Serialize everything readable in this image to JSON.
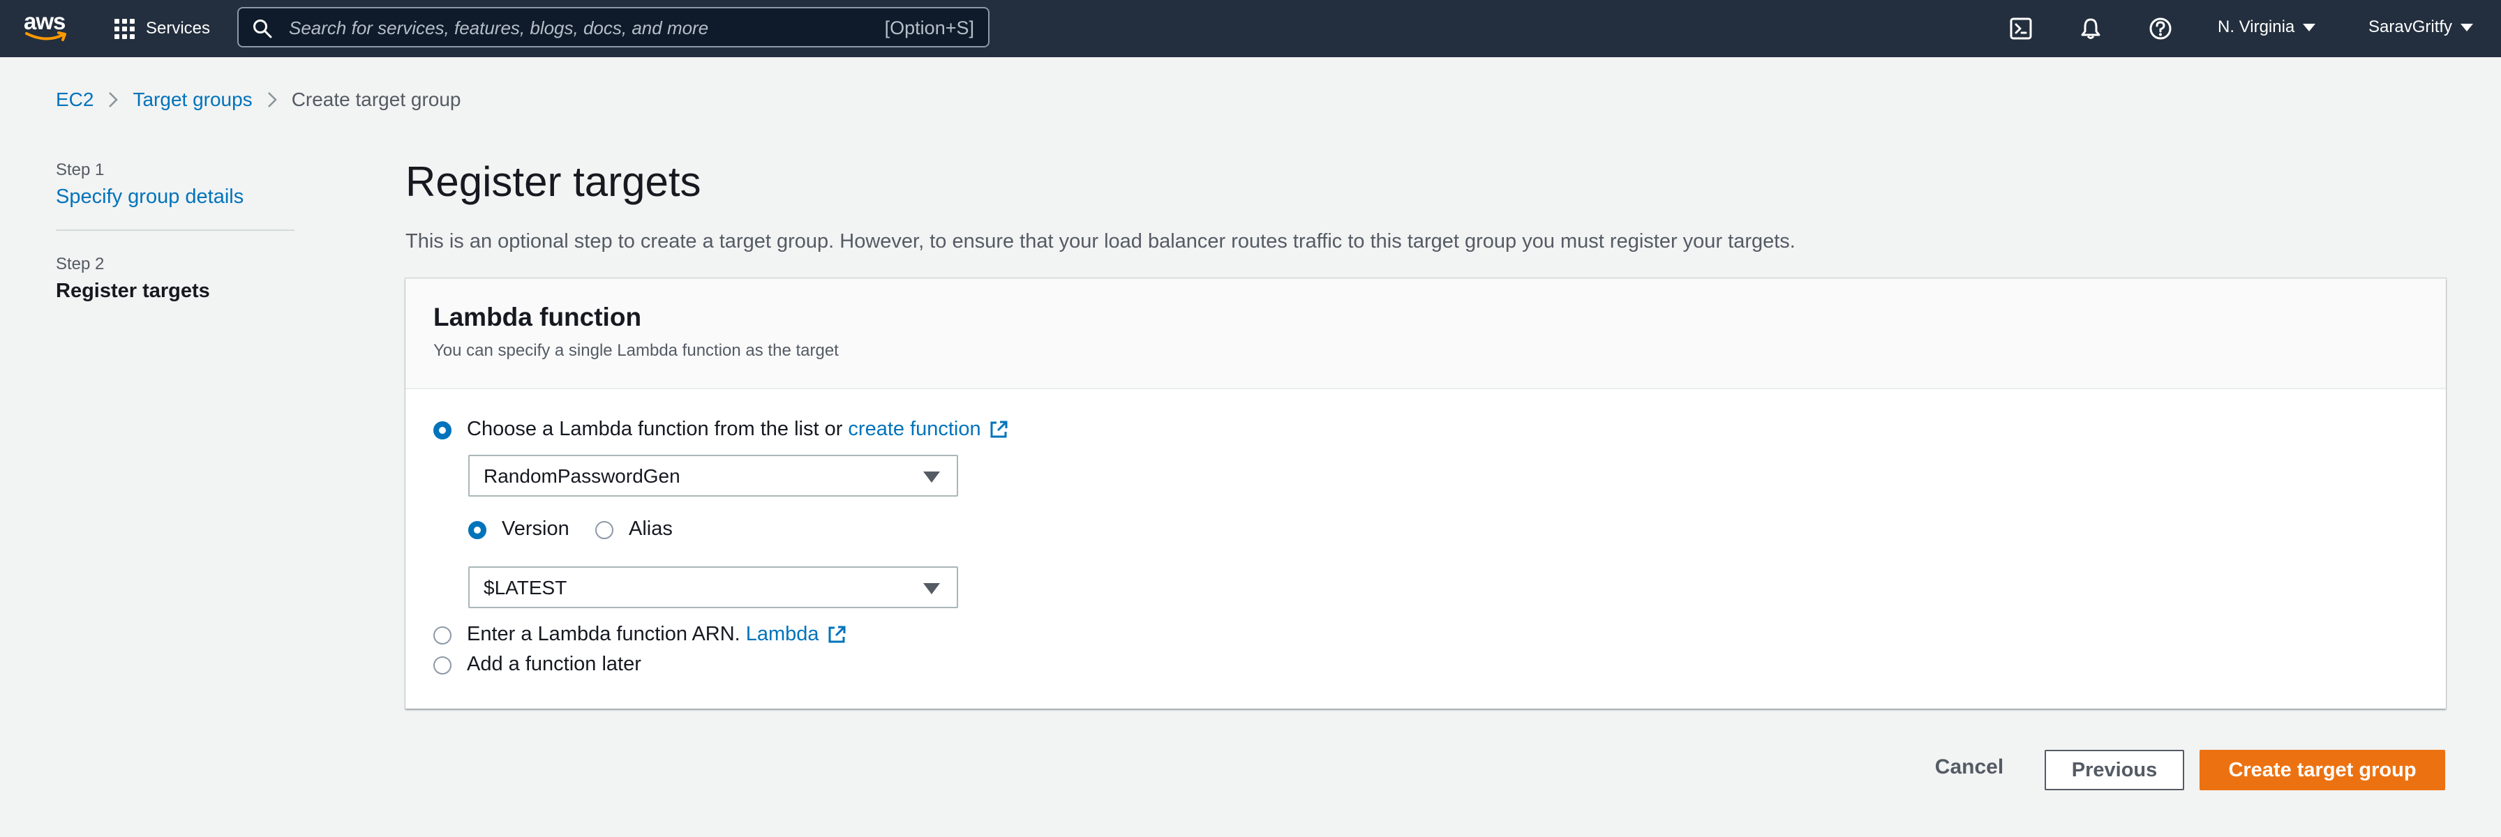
{
  "topnav": {
    "logo_text": "aws",
    "services_label": "Services",
    "search_placeholder": "Search for services, features, blogs, docs, and more",
    "search_shortcut": "[Option+S]",
    "region": "N. Virginia",
    "account": "SaravGritfy",
    "icons": [
      "grid-icon",
      "search-icon",
      "cloudshell-icon",
      "bell-icon",
      "help-icon",
      "caret-down-icon"
    ]
  },
  "breadcrumb": [
    "EC2",
    "Target groups",
    "Create target group"
  ],
  "steps": [
    {
      "step": "Step 1",
      "label": "Specify group details"
    },
    {
      "step": "Step 2",
      "label": "Register targets"
    }
  ],
  "main": {
    "title": "Register targets",
    "description": "This is an optional step to create a target group. However, to ensure that your load balancer routes traffic to this target group you must register your targets."
  },
  "panel": {
    "title": "Lambda function",
    "subtitle": "You can specify a single Lambda function as the target",
    "options": [
      {
        "label": "Choose a Lambda function from the list or",
        "link": "create function",
        "selected": true
      },
      {
        "label": "Enter a Lambda function ARN.",
        "link": "Lambda",
        "selected": false
      },
      {
        "label": "Add a function later",
        "selected": false
      }
    ],
    "function_select": "RandomPasswordGen",
    "qualifier_options": [
      {
        "label": "Version",
        "selected": true
      },
      {
        "label": "Alias",
        "selected": false
      }
    ],
    "version_select": "$LATEST"
  },
  "footer": {
    "cancel": "Cancel",
    "previous": "Previous",
    "create": "Create target group"
  },
  "colors": {
    "nav_bg": "#232f3e",
    "link": "#0073bb",
    "primary": "#ec7211",
    "page_bg": "#f2f3f3"
  }
}
